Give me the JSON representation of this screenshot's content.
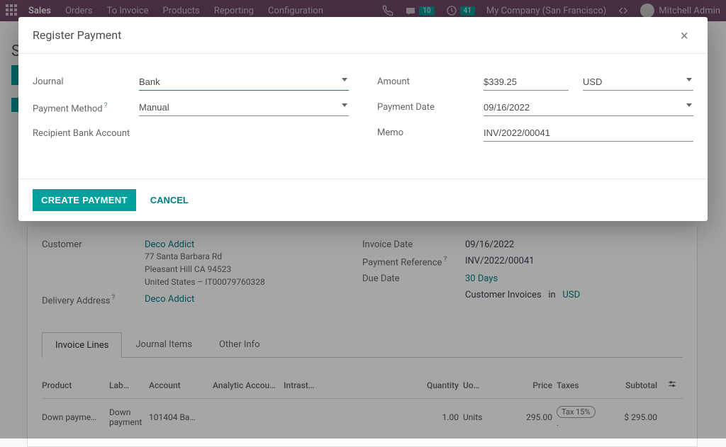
{
  "topbar": {
    "brand": "Sales",
    "nav": [
      "Orders",
      "To Invoice",
      "Products",
      "Reporting",
      "Configuration"
    ],
    "messages_count": "10",
    "activities_count": "41",
    "company": "My Company (San Francisco)",
    "user": "Mitchell Admin"
  },
  "background": {
    "breadcrumb_initial": "S",
    "customer_label": "Customer",
    "customer_name": "Deco Addict",
    "customer_addr1": "77 Santa Barbara Rd",
    "customer_addr2": "Pleasant Hill CA 94523",
    "customer_addr3": "United States – IT00079760328",
    "delivery_label": "Delivery Address",
    "delivery_value": "Deco Addict",
    "invoice_date_label": "Invoice Date",
    "invoice_date_value": "09/16/2022",
    "payment_ref_label": "Payment Reference",
    "payment_ref_value": "INV/2022/00041",
    "due_date_label": "Due Date",
    "due_date_value": "30 Days",
    "journal_text": "Customer Invoices",
    "journal_in": "in",
    "journal_currency": "USD",
    "tabs": [
      "Invoice Lines",
      "Journal Items",
      "Other Info"
    ],
    "columns": [
      "Product",
      "Lab…",
      "Account",
      "Analytic Accou…",
      "Intrast…",
      "",
      "Quantity",
      "Uo…",
      "Price",
      "Taxes",
      "Subtotal",
      ""
    ],
    "row": {
      "product": "Down payme…",
      "label": "Down payment",
      "account": "101404 Ba…",
      "analytic": "",
      "intrastat": "",
      "qty": "1.00",
      "uom": "Units",
      "price": "295.00",
      "tax": "Tax 15%",
      "tax_suffix": ".",
      "subtotal": "$ 295.00"
    }
  },
  "modal": {
    "title": "Register Payment",
    "journal_label": "Journal",
    "journal_value": "Bank",
    "payment_method_label": "Payment Method",
    "payment_method_value": "Manual",
    "recipient_bank_label": "Recipient Bank Account",
    "amount_label": "Amount",
    "amount_value": "$339.25",
    "currency_value": "USD",
    "payment_date_label": "Payment Date",
    "payment_date_value": "09/16/2022",
    "memo_label": "Memo",
    "memo_value": "INV/2022/00041",
    "create_btn": "CREATE PAYMENT",
    "cancel_btn": "CANCEL"
  }
}
